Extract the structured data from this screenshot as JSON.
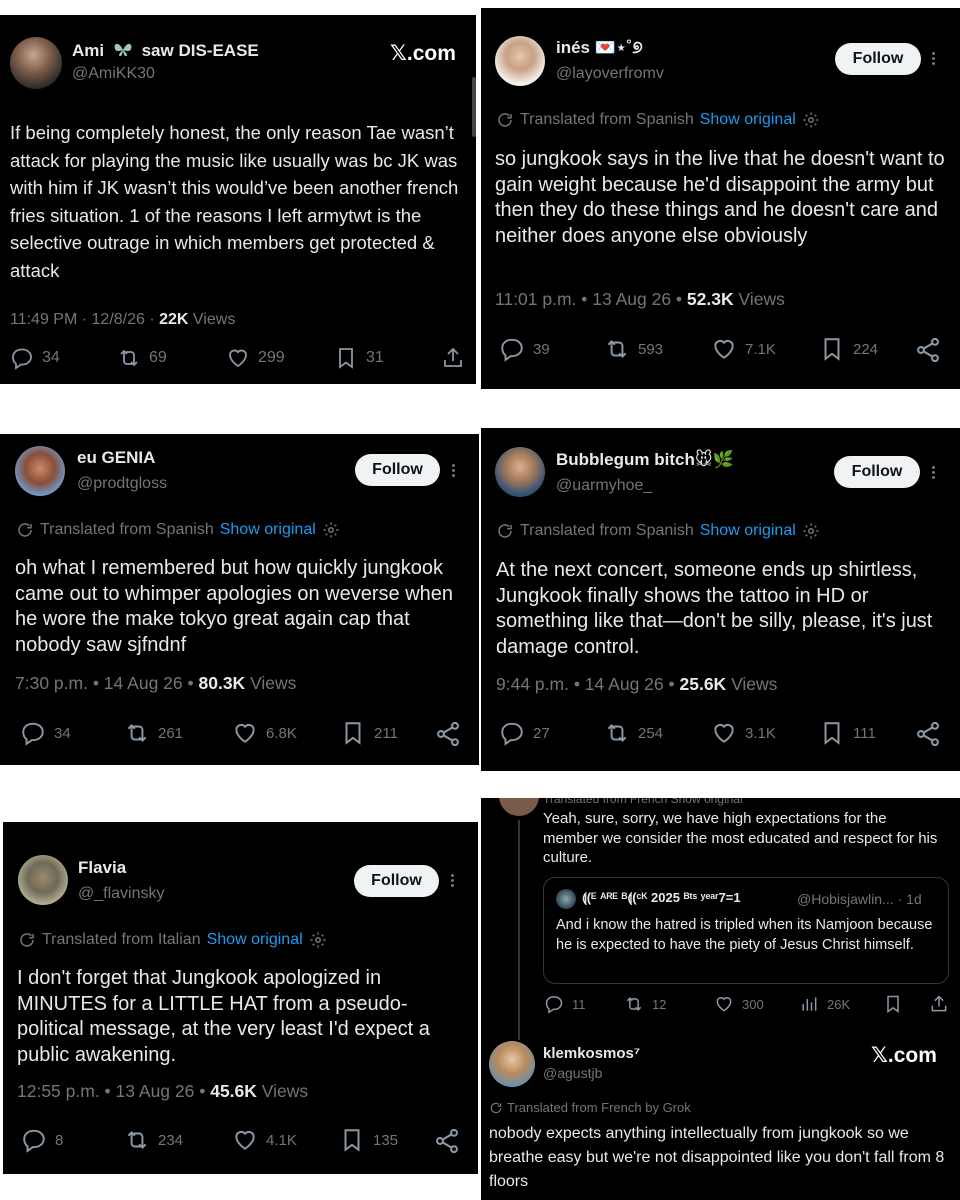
{
  "tweet1": {
    "name": "Ami",
    "name_rest": "saw DIS-EASE",
    "handle": "@AmiKK30",
    "watermark": "𝕏.com",
    "text": "If being completely honest, the only reason Tae wasn’t attack for playing the music like usually was bc JK was with him if JK wasn’t this would’ve been another french fries situation. 1 of the reasons I left armytwt is the selective outrage in which members get protected & attack",
    "time": "11:49 PM · 12/8/26 · ",
    "views_count": "22K",
    "views_label": " Views",
    "replies": "34",
    "reposts": "69",
    "likes": "299",
    "bookmarks": "31"
  },
  "tweet2": {
    "name": "inés 💌⋆˚୭",
    "handle": "@layoverfromv",
    "follow": "Follow",
    "translated": "Translated from Spanish",
    "show_original": "Show original",
    "text": "so jungkook says in the live that he doesn't want to gain weight because he'd disappoint the army but then they do these things and he doesn't care and neither does anyone else obviously",
    "time": "11:01 p.m. • 13 Aug 26 • ",
    "views_count": "52.3K",
    "views_label": " Views",
    "replies": "39",
    "reposts": "593",
    "likes": "7.1K",
    "bookmarks": "224"
  },
  "tweet3": {
    "name": "eu GENIA",
    "handle": "@prodtgloss",
    "follow": "Follow",
    "translated": "Translated from Spanish",
    "show_original": "Show original",
    "text": "oh what I remembered but how quickly jungkook came out to whimper apologies on weverse when he wore the make tokyo great again cap that nobody saw sjfndnf",
    "time": "7:30 p.m. • 14 Aug 26 • ",
    "views_count": "80.3K",
    "views_label": " Views",
    "replies": "34",
    "reposts": "261",
    "likes": "6.8K",
    "bookmarks": "211"
  },
  "tweet4": {
    "name": "Bubblegum bitch🐭🌿",
    "handle": "@uarmyhoe_",
    "follow": "Follow",
    "translated": "Translated from Spanish",
    "show_original": "Show original",
    "text": "At the next concert, someone ends up shirtless, Jungkook finally shows the tattoo in HD or something like that—don't be silly, please, it's just damage control.",
    "time": "9:44 p.m. • 14 Aug 26 • ",
    "views_count": "25.6K",
    "views_label": " Views",
    "replies": "27",
    "reposts": "254",
    "likes": "3.1K",
    "bookmarks": "111"
  },
  "tweet5": {
    "name": "Flavia",
    "handle": "@_flavinsky",
    "follow": "Follow",
    "translated": "Translated from Italian",
    "show_original": "Show original",
    "text": "I don't forget that Jungkook apologized in MINUTES for a LITTLE HAT from a pseudo-political message, at the very least I'd expect a public awakening.",
    "time": "12:55 p.m. • 13 Aug 26 • ",
    "views_count": "45.6K",
    "views_label": " Views",
    "replies": "8",
    "reposts": "234",
    "likes": "4.1K",
    "bookmarks": "135"
  },
  "tweet6": {
    "cut_top": "Translated from French  Show original",
    "text": "Yeah, sure, sorry, we have high expectations for the member we consider the most educated and respect for his culture.",
    "quote_name": "⟬(ᴱ ᴬᴿᴱ ᴮ⟬(ᶜᴷ 2025 ᴮᵗˢ ʸᵉᵃʳ7=1",
    "quote_handle": "@Hobisjawlin... · 1d",
    "quote_text": "And i know the hatred is tripled when its Namjoon because he is expected to have the piety of Jesus Christ himself.",
    "replies": "11",
    "reposts": "12",
    "likes": "300",
    "views": "26K",
    "reply_name": "klemkosmos⁷",
    "reply_handle": "@agustjb",
    "watermark": "𝕏.com",
    "reply_translated": "Translated from French by Grok",
    "reply_text": "nobody expects anything intellectually from jungkook so we breathe easy but we're not disappointed like you don't fall from 8 floors"
  }
}
